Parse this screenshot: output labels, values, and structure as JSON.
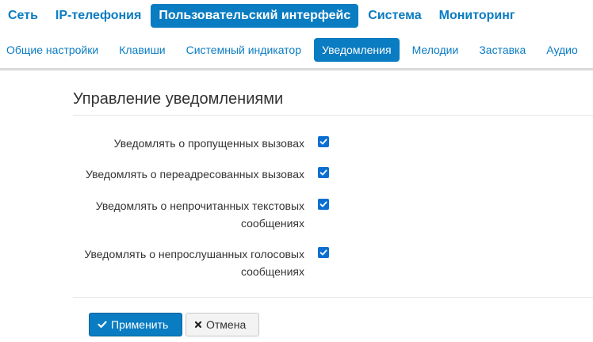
{
  "main_nav": [
    {
      "label": "Сеть",
      "active": false
    },
    {
      "label": "IP-телефония",
      "active": false
    },
    {
      "label": "Пользовательский интерфейс",
      "active": true
    },
    {
      "label": "Система",
      "active": false
    },
    {
      "label": "Мониторинг",
      "active": false
    }
  ],
  "sub_nav": [
    {
      "label": "Общие настройки",
      "active": false
    },
    {
      "label": "Клавиши",
      "active": false
    },
    {
      "label": "Системный индикатор",
      "active": false
    },
    {
      "label": "Уведомления",
      "active": true
    },
    {
      "label": "Мелодии",
      "active": false
    },
    {
      "label": "Заставка",
      "active": false
    },
    {
      "label": "Аудио",
      "active": false
    }
  ],
  "section": {
    "title": "Управление уведомлениями"
  },
  "options": [
    {
      "label_lines": [
        "Уведомлять о пропущенных вызовах"
      ],
      "checked": true
    },
    {
      "label_lines": [
        "Уведомлять о переадресованных вызовах"
      ],
      "checked": true
    },
    {
      "label_lines": [
        "Уведомлять о непрочитанных текстовых",
        "сообщениях"
      ],
      "checked": true
    },
    {
      "label_lines": [
        "Уведомлять о непрослушанных голосовых",
        "сообщениях"
      ],
      "checked": true
    }
  ],
  "buttons": {
    "apply_label": "Применить",
    "cancel_label": "Отмена"
  },
  "colors": {
    "accent": "#0a7cc2",
    "checkbox": "#0a6fd1"
  }
}
